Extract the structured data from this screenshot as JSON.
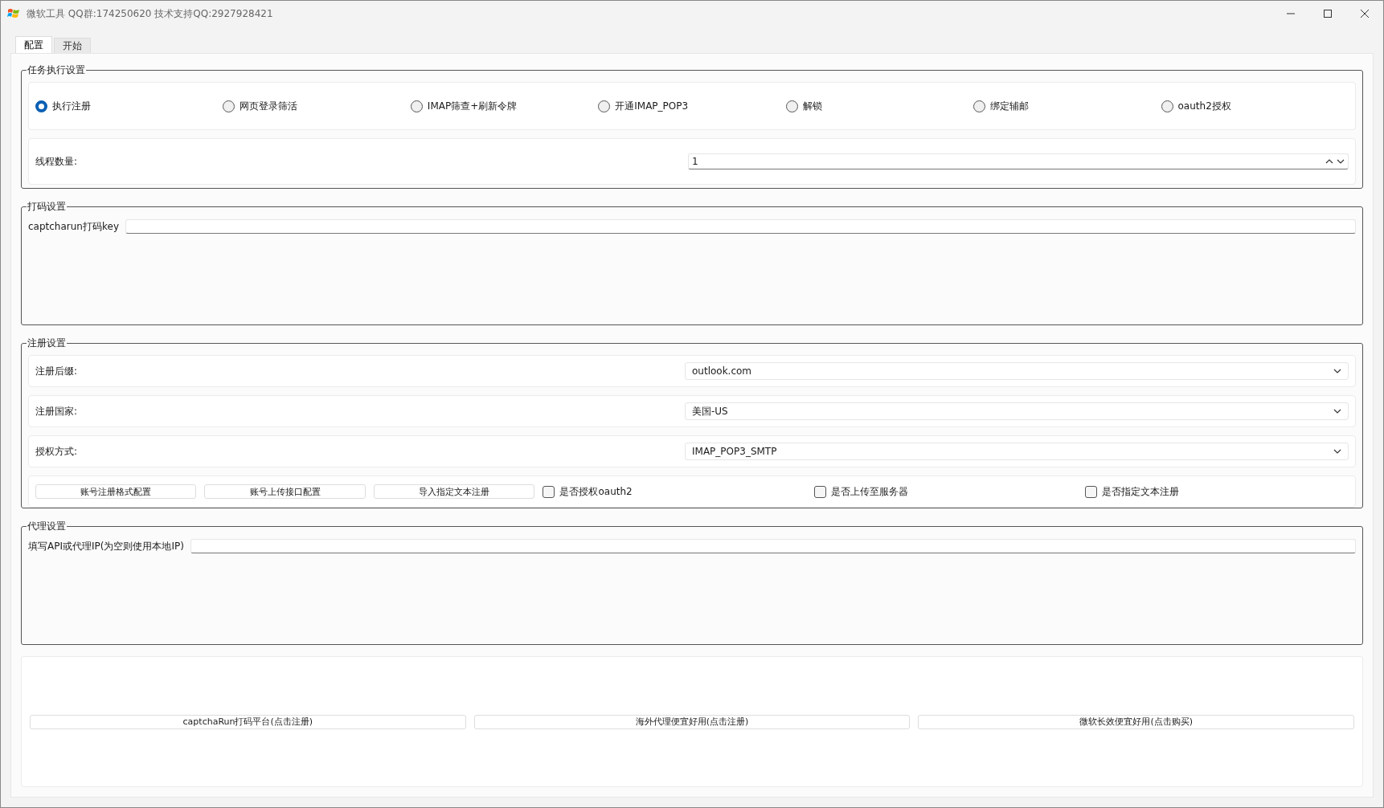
{
  "window": {
    "title": "微软工具  QQ群:174250620 技术支持QQ:2927928421"
  },
  "tabs": [
    {
      "label": "配置",
      "selected": true
    },
    {
      "label": "开始",
      "selected": false
    }
  ],
  "task_group": {
    "title": "任务执行设置",
    "modes": [
      {
        "label": "执行注册",
        "selected": true
      },
      {
        "label": "网页登录筛活",
        "selected": false
      },
      {
        "label": "IMAP筛查+刷新令牌",
        "selected": false
      },
      {
        "label": "开通IMAP_POP3",
        "selected": false
      },
      {
        "label": "解锁",
        "selected": false
      },
      {
        "label": "绑定辅邮",
        "selected": false
      },
      {
        "label": "oauth2授权",
        "selected": false
      }
    ],
    "threads": {
      "label": "线程数量:",
      "value": "1"
    }
  },
  "captcha_group": {
    "title": "打码设置",
    "label": "captcharun打码key"
  },
  "register_group": {
    "title": "注册设置",
    "selects": [
      {
        "label": "注册后缀:",
        "value": "outlook.com"
      },
      {
        "label": "注册国家:",
        "value": "美国-US"
      },
      {
        "label": "授权方式:",
        "value": "IMAP_POP3_SMTP"
      }
    ],
    "buttons": [
      "账号注册格式配置",
      "账号上传接口配置",
      "导入指定文本注册"
    ],
    "checks": [
      {
        "label": "是否授权oauth2",
        "checked": false
      },
      {
        "label": "是否上传至服务器",
        "checked": false
      },
      {
        "label": "是否指定文本注册",
        "checked": false
      }
    ]
  },
  "proxy_group": {
    "title": "代理设置",
    "label": "填写API或代理IP(为空则使用本地IP)"
  },
  "links": [
    "captchaRun打码平台(点击注册)",
    "海外代理便宜好用(点击注册)",
    "微软长效便宜好用(点击购买)"
  ]
}
